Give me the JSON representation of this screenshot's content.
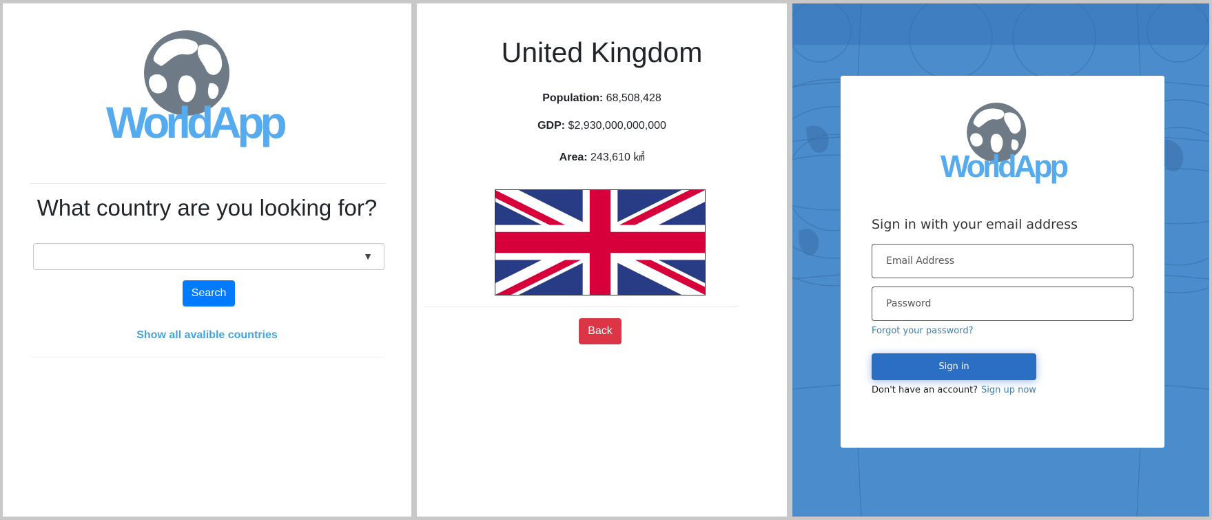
{
  "search_page": {
    "logo_text": "WorldApp",
    "heading": "What country are you looking for?",
    "country_select_value": "",
    "search_button": "Search",
    "show_all_link": "Show all avalible countries",
    "colors": {
      "search_button": "#007bff",
      "link": "#4aa3d6",
      "logo": "#55abee"
    }
  },
  "country_page": {
    "title": "United Kingdom",
    "stats": [
      {
        "label": "Population:",
        "value": "68,508,428"
      },
      {
        "label": "GDP:",
        "value": "$2,930,000,000,000"
      },
      {
        "label": "Area:",
        "value": "243,610 ㎢"
      }
    ],
    "flag": "union-jack-flag",
    "back_button": "Back",
    "colors": {
      "back_button": "#dc3545"
    }
  },
  "login_page": {
    "logo_text": "WorldApp",
    "heading": "Sign in with your email address",
    "email_placeholder": "Email Address",
    "password_placeholder": "Password",
    "forgot_link": "Forgot your password?",
    "signin_button": "Sign in",
    "no_account_text": "Don't have an account?",
    "signup_link": "Sign up now",
    "colors": {
      "background": "#4a8ccc",
      "signin_button": "#2b6fc4",
      "link": "#3f7fae"
    }
  }
}
